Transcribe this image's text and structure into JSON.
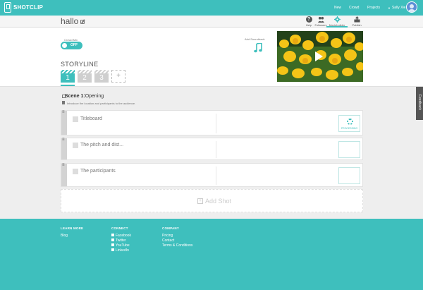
{
  "app": {
    "name": "SHOTCLIP"
  },
  "nav": {
    "new": "New",
    "crowd": "Crowd",
    "projects": "Projects",
    "user": "Sally Xie"
  },
  "toolbar": {
    "help": "Help",
    "followers": "Followers",
    "moviebuilder": "Moviebuilder",
    "publish": "Publish"
  },
  "project": {
    "title": "hallo",
    "crowd_mix_label": "Crowd Mix",
    "crowd_mix_state": "OFF",
    "soundtrack_label": "Add Soundtrack",
    "storyline_label": "STORYLINE",
    "scenes": [
      "1",
      "2",
      "3"
    ],
    "add_scene": "+"
  },
  "scene": {
    "name_prefix": "Scene 1:",
    "name": "Opening",
    "description": "Introduce the location and participants to the audience."
  },
  "shots": [
    {
      "title": "Titleboard",
      "status": "PROCESSING"
    },
    {
      "title": "The pitch and dist...",
      "status": ""
    },
    {
      "title": "The participants",
      "status": ""
    }
  ],
  "add_shot_label": "Add Shot",
  "feedback_label": "Feedback",
  "footer": {
    "learn": {
      "heading": "LEARN MORE",
      "links": [
        "Blog"
      ]
    },
    "connect": {
      "heading": "CONNECT",
      "links": [
        "Facebook",
        "Twitter",
        "YouTube",
        "LinkedIn"
      ]
    },
    "company": {
      "heading": "COMPANY",
      "links": [
        "Pricing",
        "Contact",
        "Terms & Conditions"
      ]
    }
  },
  "colors": {
    "accent": "#3ebfbd",
    "footer": "#3ebfbd",
    "scene_inactive": "#cfcfcf"
  }
}
